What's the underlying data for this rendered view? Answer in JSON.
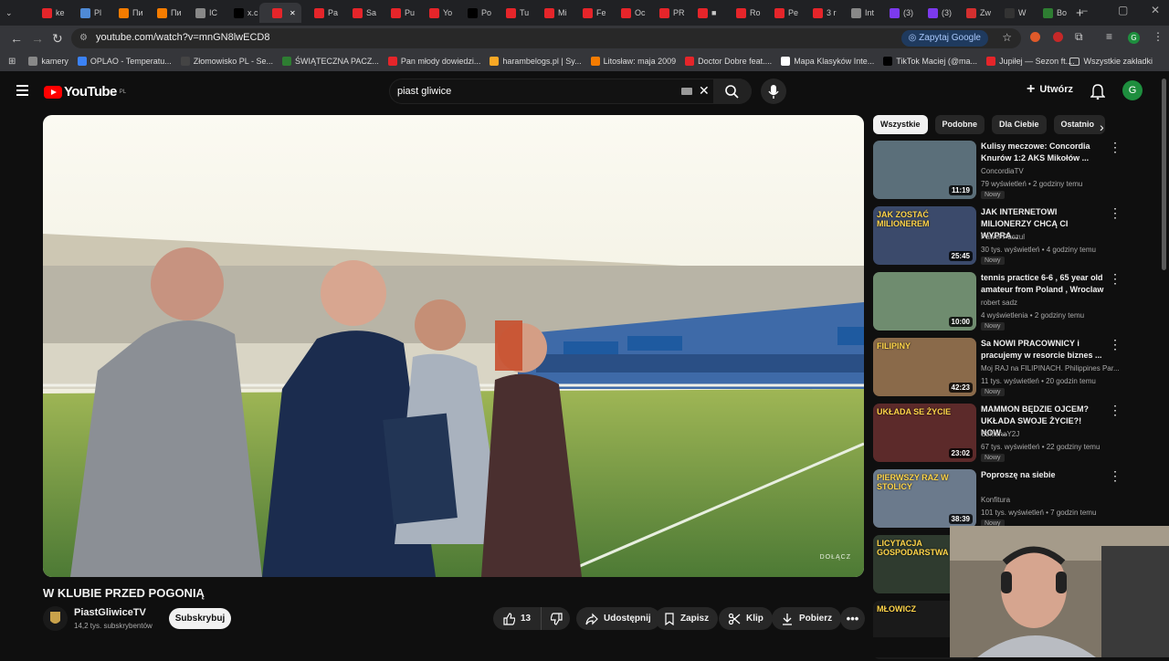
{
  "browser": {
    "tabs": [
      {
        "label": "ke",
        "color": "#e5252a"
      },
      {
        "label": "Pl",
        "color": "#4f8ad6"
      },
      {
        "label": "Пи",
        "color": "#f57c00"
      },
      {
        "label": "Пи",
        "color": "#f57c00"
      },
      {
        "label": "IC",
        "color": "#888888"
      },
      {
        "label": "x.c",
        "color": "#000000"
      },
      {
        "label": "",
        "color": "#e5252a",
        "active": true
      },
      {
        "label": "Pa",
        "color": "#e5252a"
      },
      {
        "label": "Sa",
        "color": "#e5252a"
      },
      {
        "label": "Pu",
        "color": "#e5252a"
      },
      {
        "label": "Yo",
        "color": "#e5252a"
      },
      {
        "label": "Po",
        "color": "#000000"
      },
      {
        "label": "Tu",
        "color": "#e5252a"
      },
      {
        "label": "Mi",
        "color": "#e5252a"
      },
      {
        "label": "Fe",
        "color": "#e5252a"
      },
      {
        "label": "Oc",
        "color": "#e5252a"
      },
      {
        "label": "PR",
        "color": "#e5252a"
      },
      {
        "label": "■",
        "color": "#e5252a"
      },
      {
        "label": "Ro",
        "color": "#e5252a"
      },
      {
        "label": "Pe",
        "color": "#e5252a"
      },
      {
        "label": "3 r",
        "color": "#e5252a"
      },
      {
        "label": "Int",
        "color": "#888888"
      },
      {
        "label": "(3)",
        "color": "#7c3aed"
      },
      {
        "label": "(3)",
        "color": "#7c3aed"
      },
      {
        "label": "Zw",
        "color": "#d32f2f"
      },
      {
        "label": "W",
        "color": "#333333"
      },
      {
        "label": "Bo",
        "color": "#2e7d32"
      }
    ],
    "new_tab": "+",
    "url": "youtube.com/watch?v=mnGN8lwECD8",
    "ask_google": "Zapytaj Google",
    "bookmarks": [
      {
        "label": "kamery",
        "icon": "folder-icon",
        "color": "#888888"
      },
      {
        "label": "OPLAO - Temperatu...",
        "icon": "site-icon",
        "color": "#3b82f6"
      },
      {
        "label": "Złomowisko PL - Se...",
        "icon": "site-icon",
        "color": "#444444"
      },
      {
        "label": "ŚWIĄTECZNA PACZ...",
        "icon": "site-icon",
        "color": "#2e7d32"
      },
      {
        "label": "Pan młody dowiedzi...",
        "icon": "youtube-icon",
        "color": "#e5252a"
      },
      {
        "label": "harambelogs.pl | Sy...",
        "icon": "site-icon",
        "color": "#f9a825"
      },
      {
        "label": "Litosław: maja 2009",
        "icon": "blogger-icon",
        "color": "#f57c00"
      },
      {
        "label": "Doctor Dobre feat....",
        "icon": "youtube-icon",
        "color": "#e5252a"
      },
      {
        "label": "Mapa Klasyków Inte...",
        "icon": "google-icon",
        "color": "#ffffff"
      },
      {
        "label": "TikTok Maciej (@ma...",
        "icon": "tiktok-icon",
        "color": "#000000"
      },
      {
        "label": "Jupiłej — Sezon ft....",
        "icon": "youtube-icon",
        "color": "#e5252a"
      }
    ],
    "all_bookmarks": "Wszystkie zakładki"
  },
  "youtube": {
    "logo_text": "YouTube",
    "logo_region": "PL",
    "search_query": "piast gliwice",
    "create_label": "Utwórz",
    "avatar_letter": "G",
    "accent": "#ff0000"
  },
  "video": {
    "title": "W KLUBIE PRZED POGONIĄ",
    "watermark": "DOŁĄCZ",
    "channel_name": "PiastGliwiceTV",
    "subscribers": "14,2 tys. subskrybentów",
    "subscribe_label": "Subskrybuj",
    "like_count": "13",
    "share_label": "Udostępnij",
    "save_label": "Zapisz",
    "clip_label": "Klip",
    "download_label": "Pobierz"
  },
  "chips": [
    "Wszystkie",
    "Podobne",
    "Dla Ciebie",
    "Ostatnio"
  ],
  "recommendations": [
    {
      "title": "Kulisy meczowe: Concordia Knurów 1:2 AKS Mikołów ...",
      "channel": "ConcordiaTV",
      "meta": "79 wyświetleń • 2 godziny temu",
      "badge": "Nowy",
      "duration": "11:19"
    },
    {
      "title": "JAK INTERNETOWI MILIONERZY CHCĄ CI WYPRA...",
      "channel": "Paweł Paczul",
      "meta": "30 tys. wyświetleń • 4 godziny temu",
      "badge": "Nowy",
      "duration": "25:45",
      "thumb_text": "JAK ZOSTAĆ MILIONEREM"
    },
    {
      "title": "tennis practice 6-6 , 65 year old amateur from Poland , Wroclaw",
      "channel": "robert sadz",
      "meta": "4 wyświetlenia • 2 godziny temu",
      "badge": "Nowy",
      "duration": "10:00"
    },
    {
      "title": "Sa NOWI PRACOWNICY i pracujemy w resorcie biznes ...",
      "channel": "Moj RAJ na FILIPINACH. Philippines Par...",
      "meta": "11 tys. wyświetleń • 20 godzin temu",
      "badge": "Nowy",
      "duration": "42:23",
      "thumb_text": "FILIPINY"
    },
    {
      "title": "MAMMON BĘDZIE OJCEM? UKŁADA SWOJE ŻYCIE?! NOW...",
      "channel": "SzklanaY2J",
      "meta": "67 tys. wyświetleń • 22 godziny temu",
      "badge": "Nowy",
      "duration": "23:02",
      "thumb_text": "UKŁADA SE ŻYCIE"
    },
    {
      "title": "Poproszę na siebie",
      "channel": "Konfitura",
      "meta": "101 tys. wyświetleń • 7 godzin temu",
      "badge": "Nowy",
      "duration": "38:39",
      "thumb_text": "PIERWSZY RAZ W STOLICY"
    },
    {
      "title": "",
      "channel": "",
      "meta": "",
      "badge": "",
      "duration": "",
      "thumb_text": "LICYTACJA GOSPODARSTWA"
    },
    {
      "title": "",
      "channel": "",
      "meta": "",
      "badge": "",
      "duration": "",
      "thumb_text": "MŁOWICZ"
    }
  ]
}
